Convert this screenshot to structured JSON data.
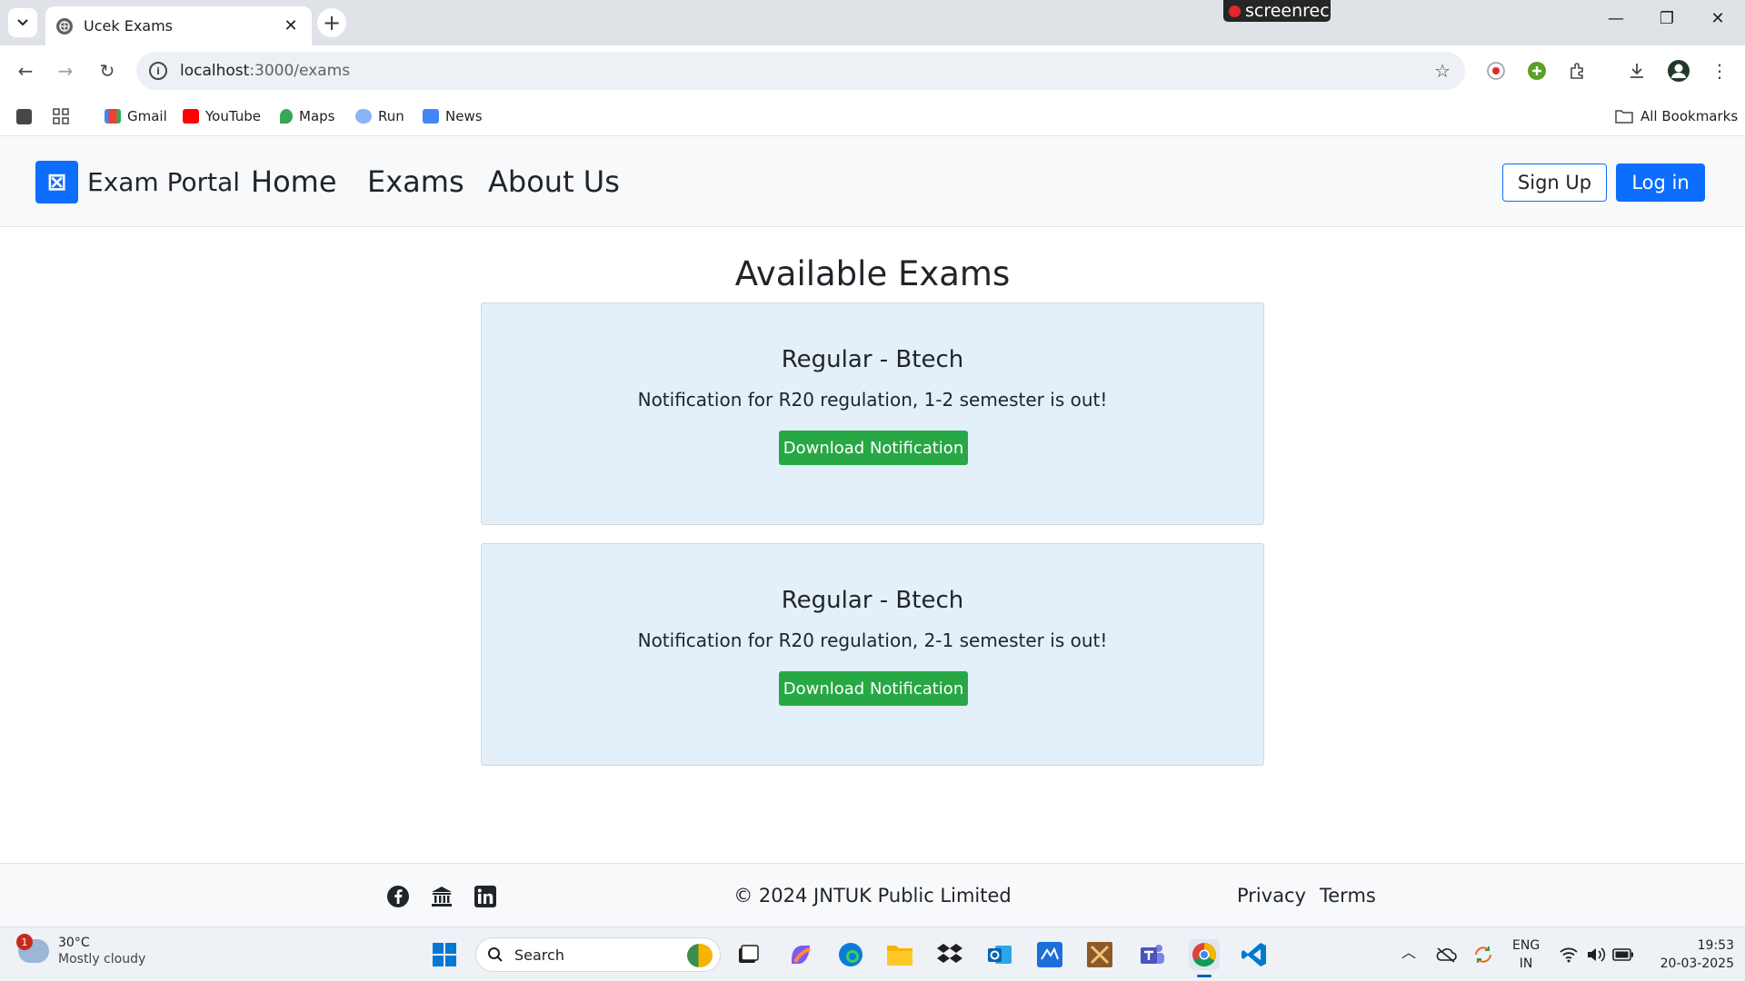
{
  "browser": {
    "tab_title": "Ucek Exams",
    "url_host": "localhost",
    "url_path": ":3000/exams",
    "recorder": "screenrec",
    "bookmarks": [
      "Gmail",
      "YouTube",
      "Maps",
      "Run",
      "News"
    ],
    "all_bookmarks": "All Bookmarks"
  },
  "navbar": {
    "brand": "Exam Portal",
    "links": [
      "Home",
      "Exams",
      "About Us"
    ],
    "signup": "Sign Up",
    "login": "Log in"
  },
  "page": {
    "title": "Available Exams",
    "exams": [
      {
        "title": "Regular - Btech",
        "text": "Notification for R20 regulation, 1-2 semester is out!",
        "button": "Download Notification"
      },
      {
        "title": "Regular - Btech",
        "text": "Notification for R20 regulation, 2-1 semester is out!",
        "button": "Download Notification"
      }
    ]
  },
  "footer": {
    "social_icons": [
      "facebook-icon",
      "bank-icon",
      "linkedin-icon"
    ],
    "copyright": "© 2024 JNTUK Public Limited",
    "links": [
      "Privacy",
      "Terms"
    ]
  },
  "taskbar": {
    "weather_temp": "30°C",
    "weather_desc": "Mostly cloudy",
    "weather_badge": "1",
    "search": "Search",
    "lang_top": "ENG",
    "lang_bottom": "IN",
    "time": "19:53",
    "date": "20-03-2025"
  },
  "colors": {
    "primary": "#0d6efd",
    "success": "#28a745",
    "card_bg": "#e3f0fa"
  }
}
